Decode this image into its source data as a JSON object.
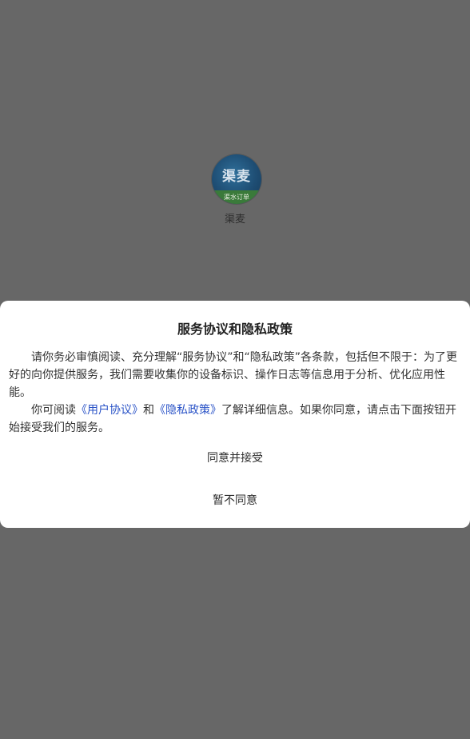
{
  "app": {
    "name": "渠麦",
    "logo_text": "渠麦",
    "logo_sub": "渠水订单"
  },
  "dialog": {
    "title": "服务协议和隐私政策",
    "para1": "请你务必审慎阅读、充分理解“服务协议”和“隐私政策”各条款，包括但不限于：为了更好的向你提供服务，我们需要收集你的设备标识、操作日志等信息用于分析、优化应用性能。",
    "para2_prefix": "你可阅读",
    "user_agreement_link": "《用户协议》",
    "para2_and": "和",
    "privacy_policy_link": "《隐私政策》",
    "para2_suffix": "了解详细信息。如果你同意，请点击下面按钮开始接受我们的服务。",
    "agree_label": "同意并接受",
    "disagree_label": "暂不同意"
  }
}
